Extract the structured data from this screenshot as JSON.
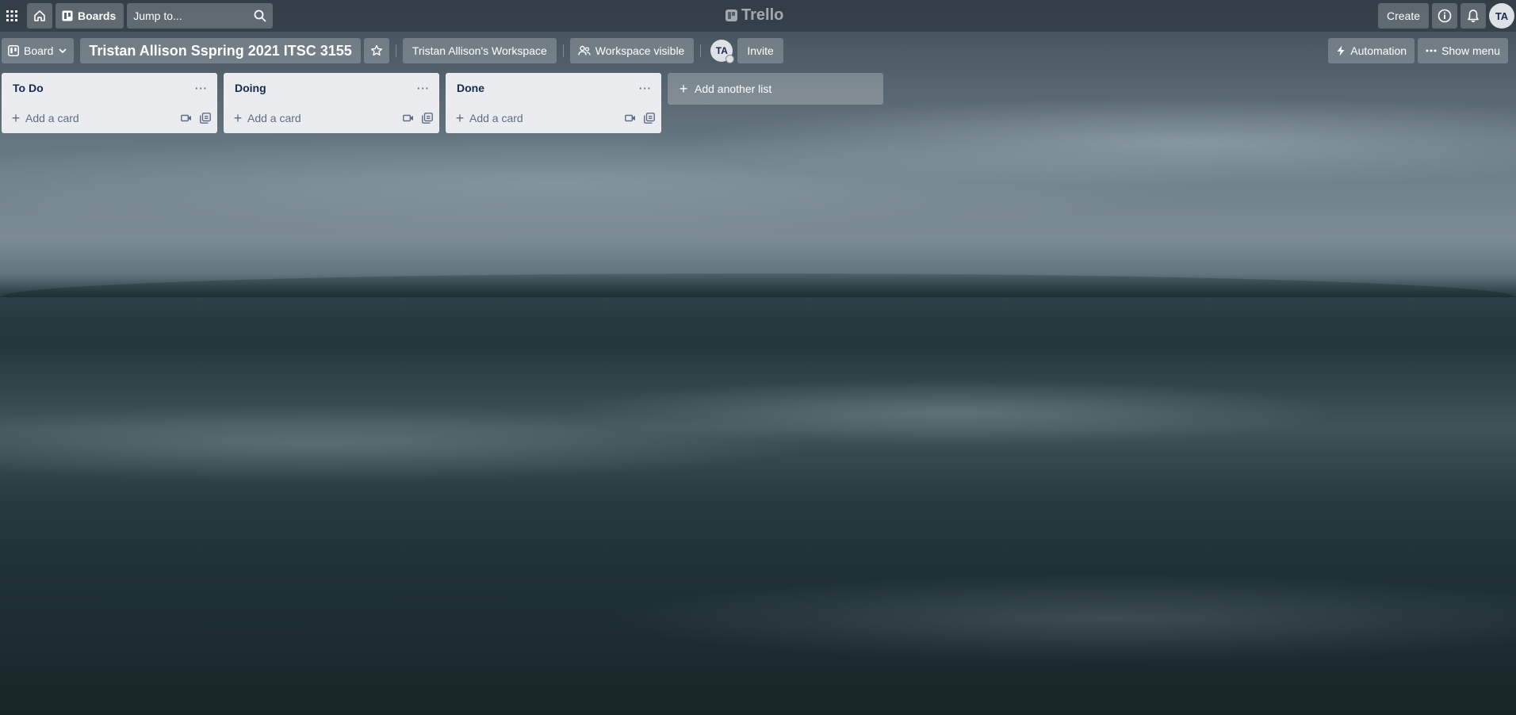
{
  "topbar": {
    "boards_label": "Boards",
    "search_placeholder": "Jump to...",
    "logo_text": "Trello",
    "create_label": "Create",
    "user_initials": "TA"
  },
  "board": {
    "view_label": "Board",
    "title": "Tristan Allison Sspring 2021 ITSC 3155",
    "workspace_label": "Tristan Allison's Workspace",
    "visibility_label": "Workspace visible",
    "member_initials": "TA",
    "invite_label": "Invite",
    "automation_label": "Automation",
    "show_menu_label": "Show menu"
  },
  "lists": [
    {
      "title": "To Do",
      "add_card_label": "Add a card"
    },
    {
      "title": "Doing",
      "add_card_label": "Add a card"
    },
    {
      "title": "Done",
      "add_card_label": "Add a card"
    }
  ],
  "add_list_label": "Add another list",
  "colors": {
    "list_bg": "#ebecf0",
    "list_text": "#172b4d",
    "muted_text": "#5e6c84"
  }
}
